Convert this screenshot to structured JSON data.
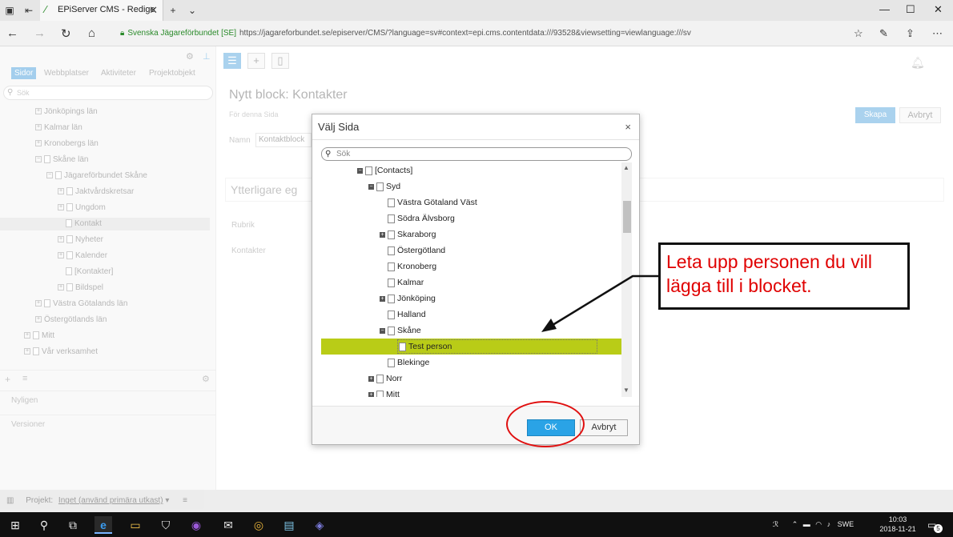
{
  "browser": {
    "tab_title": "EPiServer CMS - Redige",
    "site_identity": "Svenska Jägareförbundet [SE]",
    "url": "https://jagareforbundet.se/episerver/CMS/?language=sv#context=epi.cms.contentdata:///93528&viewsetting=viewlanguage:///sv"
  },
  "left_panel": {
    "tabs": [
      "Sidor",
      "Webbplatser",
      "Aktiviteter",
      "Projektobjekt"
    ],
    "search_placeholder": "Sök",
    "tree": [
      {
        "label": "Jönköpings län"
      },
      {
        "label": "Kalmar län"
      },
      {
        "label": "Kronobergs län"
      },
      {
        "label": "Skåne län"
      },
      {
        "label": "Jägareförbundet Skåne"
      },
      {
        "label": "Jaktvårdskretsar"
      },
      {
        "label": "Ungdom"
      },
      {
        "label": "Kontakt"
      },
      {
        "label": "Nyheter"
      },
      {
        "label": "Kalender"
      },
      {
        "label": "[Kontakter]"
      },
      {
        "label": "Bildspel"
      },
      {
        "label": "Västra Götalands län"
      },
      {
        "label": "Östergötlands län"
      },
      {
        "label": "Mitt"
      },
      {
        "label": "Vår verksamhet"
      }
    ],
    "sections": [
      "Nyligen",
      "Versioner"
    ]
  },
  "main": {
    "title": "Nytt block: Kontakter",
    "for_page": "För denna Sida",
    "name_label": "Namn",
    "name_value": "Kontaktblock",
    "create_label": "Skapa",
    "cancel_label": "Avbryt",
    "more_props": "Ytterligare eg",
    "prop_labels": [
      "Rubrik",
      "Kontakter"
    ]
  },
  "project_bar": {
    "label": "Projekt:",
    "value": "Inget (använd primära utkast)"
  },
  "dialog": {
    "title": "Välj Sida",
    "close_symbol": "×",
    "search_placeholder": "Sök",
    "tree": [
      {
        "label": "[Contacts]",
        "indent": 3,
        "expander": "minus"
      },
      {
        "label": "Syd",
        "indent": 4,
        "expander": "minus"
      },
      {
        "label": "Västra Götaland Väst",
        "indent": 5,
        "expander": "none"
      },
      {
        "label": "Södra Älvsborg",
        "indent": 5,
        "expander": "none"
      },
      {
        "label": "Skaraborg",
        "indent": 5,
        "expander": "plus"
      },
      {
        "label": "Östergötland",
        "indent": 5,
        "expander": "none"
      },
      {
        "label": "Kronoberg",
        "indent": 5,
        "expander": "none"
      },
      {
        "label": "Kalmar",
        "indent": 5,
        "expander": "none"
      },
      {
        "label": "Jönköping",
        "indent": 5,
        "expander": "plus"
      },
      {
        "label": "Halland",
        "indent": 5,
        "expander": "none"
      },
      {
        "label": "Skåne",
        "indent": 5,
        "expander": "minus"
      },
      {
        "label": "Test person",
        "indent": 6,
        "expander": "none",
        "selected": true
      },
      {
        "label": "Blekinge",
        "indent": 5,
        "expander": "none"
      },
      {
        "label": "Norr",
        "indent": 4,
        "expander": "plus"
      },
      {
        "label": "Mitt",
        "indent": 4,
        "expander": "plus"
      }
    ],
    "ok_label": "OK",
    "cancel_label": "Avbryt"
  },
  "callout": {
    "text": "Leta upp personen du vill lägga till i blocket."
  },
  "taskbar": {
    "tray_text": "SWE",
    "time": "10:03",
    "date": "2018-11-21",
    "notification_count": "5"
  },
  "colors": {
    "accent": "#2aa3e6",
    "selection": "#b9cc17",
    "annotation": "#e00000"
  }
}
